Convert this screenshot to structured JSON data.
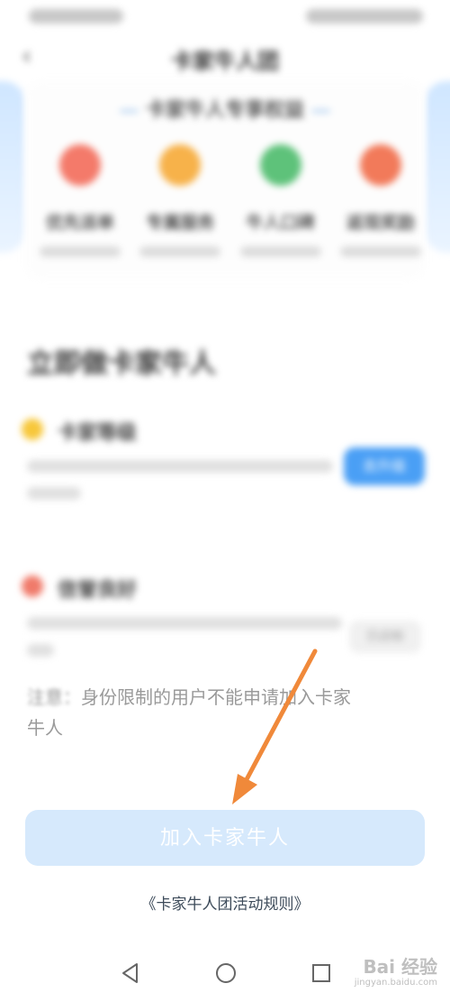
{
  "header": {
    "back_icon": "‹",
    "title": "卡家牛人团"
  },
  "benefits_section": {
    "heading": "卡家牛人专享权益",
    "items": [
      {
        "title": "优先派单",
        "color": "#f47a6a"
      },
      {
        "title": "专属服务",
        "color": "#f7b24a"
      },
      {
        "title": "牛人口碑",
        "color": "#5ec27a"
      },
      {
        "title": "返现奖励",
        "color": "#f27a5a"
      }
    ]
  },
  "apply_section": {
    "title": "立即做卡家牛人",
    "requirements": [
      {
        "title": "卡家等级",
        "color": "#f7c73a",
        "button": "去升级"
      },
      {
        "title": "信誉良好",
        "color": "#f07a6a",
        "button": "已达标"
      }
    ]
  },
  "note": {
    "prefix": "注意：",
    "text": "身份限制的用户不能申请加入卡家牛人"
  },
  "join_button": "加入卡家牛人",
  "rules_link": "《卡家牛人团活动规则》",
  "watermark": {
    "main": "Bai 经验",
    "domain": "jingyan.baidu.com"
  }
}
